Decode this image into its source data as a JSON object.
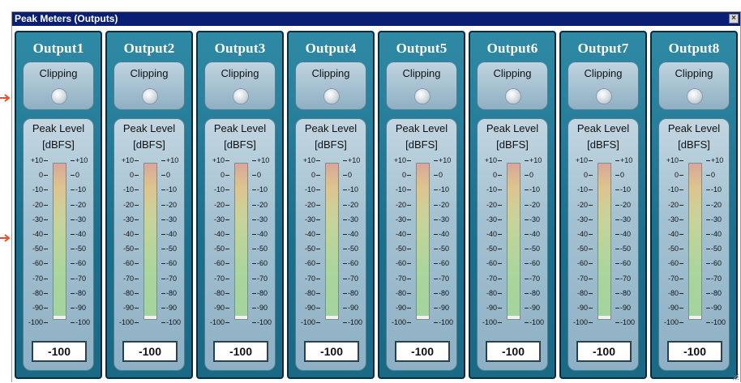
{
  "window": {
    "title": "Peak Meters (Outputs)",
    "close_glyph": "×"
  },
  "channels": [
    {
      "name": "Output1",
      "clipping_label": "Clipping",
      "peak_label": "Peak Level",
      "unit_label": "[dBFS]",
      "value": "-100",
      "level": -100,
      "clipping": false
    },
    {
      "name": "Output2",
      "clipping_label": "Clipping",
      "peak_label": "Peak Level",
      "unit_label": "[dBFS]",
      "value": "-100",
      "level": -100,
      "clipping": false
    },
    {
      "name": "Output3",
      "clipping_label": "Clipping",
      "peak_label": "Peak Level",
      "unit_label": "[dBFS]",
      "value": "-100",
      "level": -100,
      "clipping": false
    },
    {
      "name": "Output4",
      "clipping_label": "Clipping",
      "peak_label": "Peak Level",
      "unit_label": "[dBFS]",
      "value": "-100",
      "level": -100,
      "clipping": false
    },
    {
      "name": "Output5",
      "clipping_label": "Clipping",
      "peak_label": "Peak Level",
      "unit_label": "[dBFS]",
      "value": "-100",
      "level": -100,
      "clipping": false
    },
    {
      "name": "Output6",
      "clipping_label": "Clipping",
      "peak_label": "Peak Level",
      "unit_label": "[dBFS]",
      "value": "-100",
      "level": -100,
      "clipping": false
    },
    {
      "name": "Output7",
      "clipping_label": "Clipping",
      "peak_label": "Peak Level",
      "unit_label": "[dBFS]",
      "value": "-100",
      "level": -100,
      "clipping": false
    },
    {
      "name": "Output8",
      "clipping_label": "Clipping",
      "peak_label": "Peak Level",
      "unit_label": "[dBFS]",
      "value": "-100",
      "level": -100,
      "clipping": false
    }
  ],
  "scale_ticks": [
    "+10",
    "0",
    "-10",
    "-20",
    "-30",
    "-40",
    "-50",
    "-60",
    "-70",
    "-80",
    "-90",
    "-100"
  ],
  "scale_range": [
    -100,
    10
  ],
  "colors": {
    "titlebar": "#0a1f73",
    "strip": "#1b6f8c",
    "annotation_arrow": "#e0502a"
  },
  "icons": {
    "close": "close-icon",
    "resize": "resize-grip-icon",
    "arrow": "arrow-right-icon"
  }
}
